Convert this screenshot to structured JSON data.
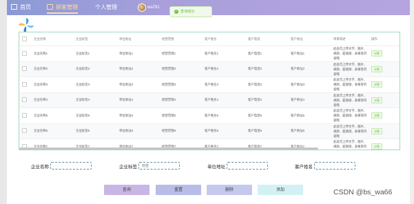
{
  "nav": {
    "home": "首页",
    "business": "顾客管理",
    "personal": "个人管理",
    "username": "wa781"
  },
  "toast": {
    "message": "查询成功"
  },
  "table": {
    "headers": [
      "企业名称",
      "企业标签",
      "单位地址",
      "经营范围",
      "客户姓名",
      "客户电话",
      "客户地址",
      "项目简述",
      "操作"
    ],
    "rows": [
      [
        "企业名称1",
        "企业标签1",
        "单位地址1",
        "经营范围1",
        "客户姓名1",
        "客户电话1",
        "客户地址1",
        "此处可上传文字、图片、视频、超链接、表格等内容哦",
        "详情"
      ],
      [
        "企业名称2",
        "企业标签2",
        "单位地址2",
        "经营范围2",
        "客户姓名2",
        "客户电话2",
        "客户地址2",
        "此处可上传文字、图片、视频、超链接、表格等内容哦",
        "详情"
      ],
      [
        "企业名称3",
        "企业标签3",
        "单位地址3",
        "经营范围3",
        "客户姓名3",
        "客户电话3",
        "客户地址3",
        "此处可上传文字、图片、视频、超链接、表格等内容哦",
        "详情"
      ],
      [
        "企业名称4",
        "企业标签4",
        "单位地址4",
        "经营范围4",
        "客户姓名4",
        "客户电话4",
        "客户地址4",
        "此处可上传文字、图片、视频、超链接、表格等内容哦",
        "详情"
      ],
      [
        "企业名称5",
        "企业标签5",
        "单位地址5",
        "经营范围5",
        "客户姓名5",
        "客户电话5",
        "客户地址5",
        "此处可上传文字、图片、视频、超链接、表格等内容哦",
        "详情"
      ],
      [
        "企业名称6",
        "企业标签6",
        "单位地址6",
        "经营范围6",
        "客户姓名6",
        "客户电话6",
        "客户地址6",
        "此处可上传文字、图片、视频、超链接、表格等内容哦",
        "详情"
      ],
      [
        "企业名称7",
        "企业标签7",
        "单位地址7",
        "经营范围7",
        "客户姓名7",
        "客户电话7",
        "客户地址7",
        "此处可上传文字、图片、视频、超链接、表格等内容哦",
        "详情"
      ]
    ]
  },
  "filters": {
    "company_name": {
      "label": "企业名称",
      "value": ""
    },
    "company_tag": {
      "label": "企业标签",
      "placeholder": "标签"
    },
    "address": {
      "label": "单位地址",
      "value": ""
    },
    "customer_name": {
      "label": "客户姓名",
      "value": ""
    }
  },
  "actions": {
    "query": "查询",
    "reset": "重置",
    "delete": "删除",
    "add": "添加"
  },
  "watermark": "CSDN @bs_wa66",
  "colors": {
    "topbar": "#a99fdb",
    "active_nav": "#ffdca0",
    "success": "#67c23a",
    "table_border": "#9fd9b8"
  }
}
